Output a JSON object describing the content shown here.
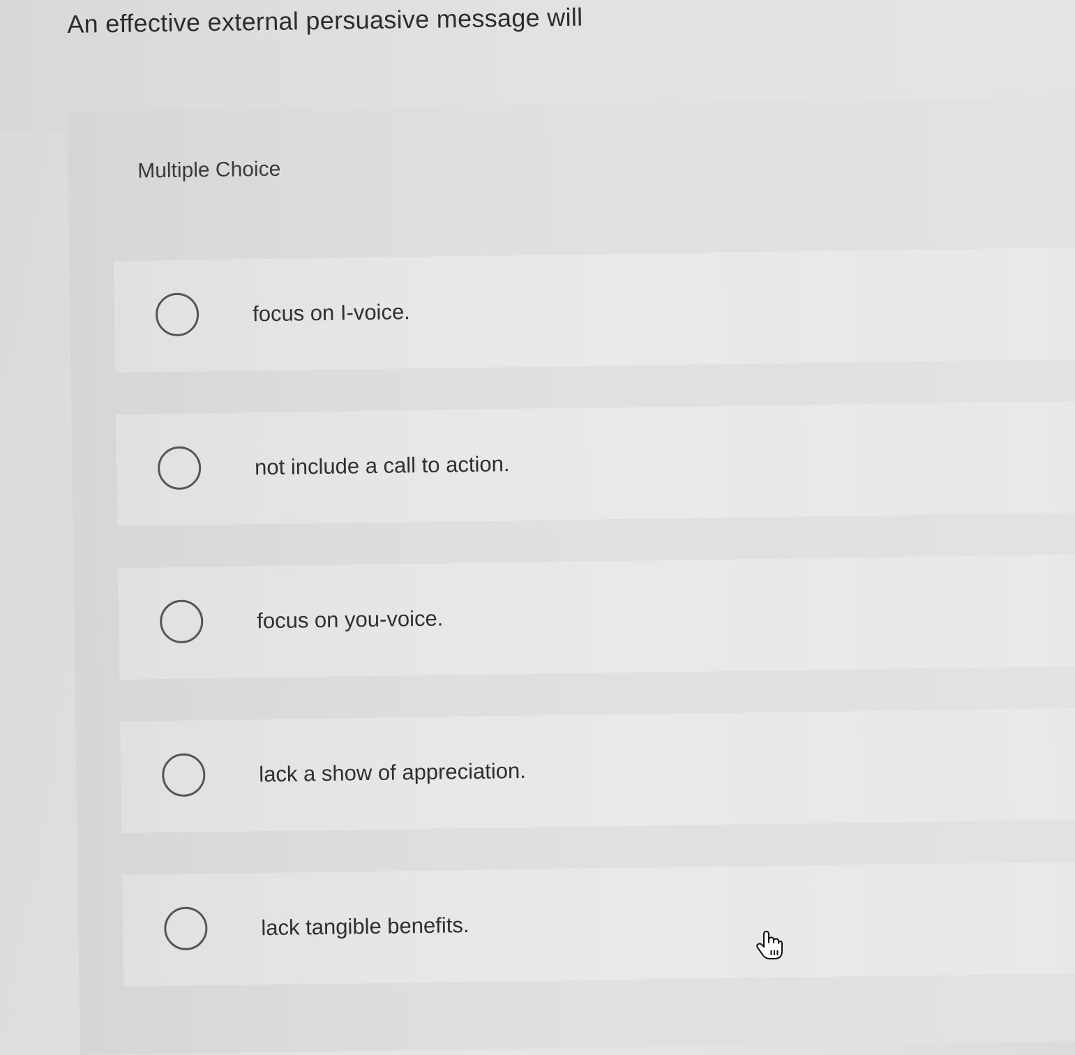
{
  "question": {
    "text": "An effective external persuasive message will"
  },
  "choice_panel": {
    "type_label": "Multiple Choice",
    "options": [
      {
        "label": "focus on I-voice.",
        "selected": false
      },
      {
        "label": "not include a call to action.",
        "selected": false
      },
      {
        "label": "focus on you-voice.",
        "selected": false
      },
      {
        "label": "lack a show of appreciation.",
        "selected": false
      },
      {
        "label": "lack tangible benefits.",
        "selected": false
      }
    ]
  },
  "cursor": {
    "icon": "hand-pointer-icon"
  }
}
